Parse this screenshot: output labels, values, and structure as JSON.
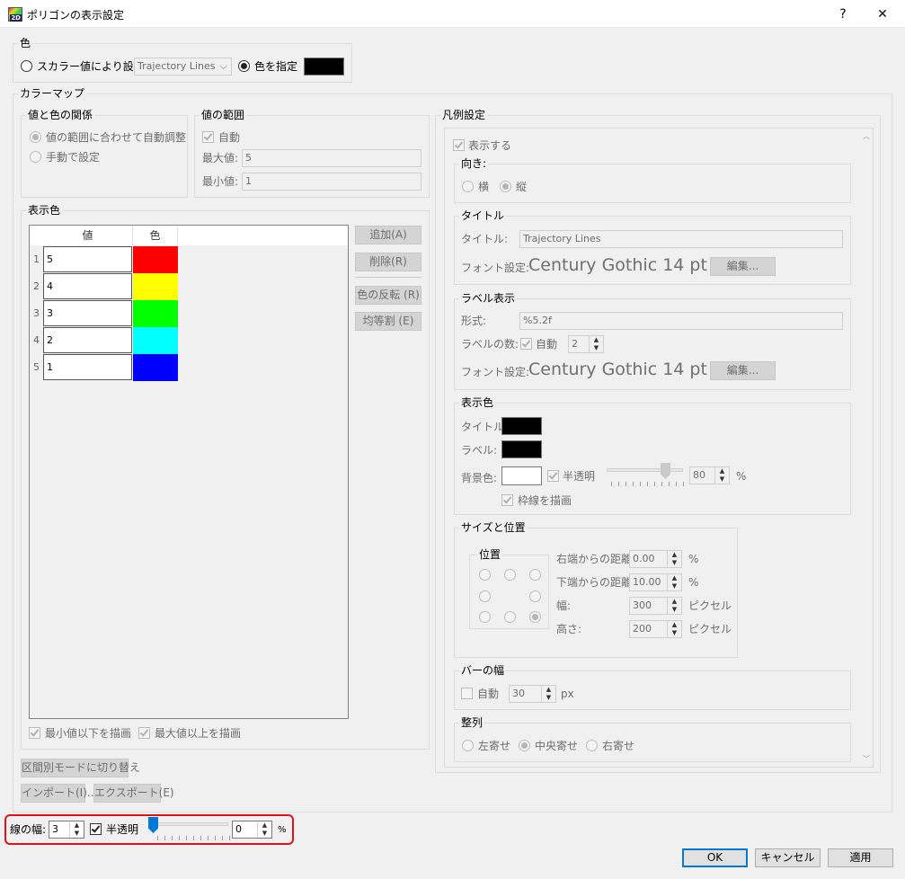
{
  "window": {
    "title": "ポリゴンの表示設定",
    "help_label": "?",
    "close_label": "✕"
  },
  "color_section": {
    "title": "色",
    "scalar_label": "スカラー値により設定",
    "scalar_select": "Trajectory Lines",
    "specify_label": "色を指定",
    "specify_color": "#000000"
  },
  "colormap": {
    "title": "カラーマップ",
    "relation": {
      "title": "値と色の関係",
      "auto_label": "値の範囲に合わせて自動調整",
      "manual_label": "手動で設定"
    },
    "range": {
      "title": "値の範囲",
      "auto_label": "自動",
      "max_label": "最大値:",
      "max_value": "5",
      "min_label": "最小値:",
      "min_value": "1"
    },
    "display_colors": {
      "title": "表示色",
      "col_value": "値",
      "col_color": "色",
      "rows": [
        {
          "index": "1",
          "value": "5",
          "color": "#ff0000"
        },
        {
          "index": "2",
          "value": "4",
          "color": "#ffff00"
        },
        {
          "index": "3",
          "value": "3",
          "color": "#00ff00"
        },
        {
          "index": "4",
          "value": "2",
          "color": "#00ffff"
        },
        {
          "index": "5",
          "value": "1",
          "color": "#0000ff"
        }
      ],
      "add_button": "追加(A)",
      "delete_button": "削除(R)",
      "invert_button": "色の反転 (R)",
      "equal_button": "均等割 (E)",
      "draw_below_min": "最小値以下を描画",
      "draw_above_max": "最大値以上を描画"
    },
    "switch_mode_button": "区間別モードに切り替え",
    "import_button": "インポート(I)...",
    "export_button": "エクスポート(E)"
  },
  "legend": {
    "title": "凡例設定",
    "show_label": "表示する",
    "orientation": {
      "title": "向き:",
      "horizontal": "横",
      "vertical": "縦"
    },
    "title_group": {
      "title": "タイトル",
      "title_label": "タイトル:",
      "title_value": "Trajectory Lines",
      "font_label": "フォント設定:",
      "font_preview": "Century Gothic 14 pt",
      "edit_button": "編集..."
    },
    "label_group": {
      "title": "ラベル表示",
      "format_label": "形式:",
      "format_value": "%5.2f",
      "count_label": "ラベルの数:",
      "auto_label": "自動",
      "count_value": "2",
      "font_label": "フォント設定:",
      "font_preview": "Century Gothic 14 pt",
      "edit_button": "編集..."
    },
    "color_group": {
      "title": "表示色",
      "title_label": "タイトル:",
      "title_color": "#000000",
      "label_label": "ラベル:",
      "label_color": "#000000",
      "bg_label": "背景色:",
      "bg_color": "#ffffff",
      "semi_label": "半透明",
      "semi_value": "80",
      "percent": "%",
      "border_label": "枠線を描画"
    },
    "size_group": {
      "title": "サイズと位置",
      "position_title": "位置",
      "right_label": "右端からの距離",
      "right_value": "0.00",
      "right_unit": "%",
      "bottom_label": "下端からの距離",
      "bottom_value": "10.00",
      "bottom_unit": "%",
      "width_label": "幅:",
      "width_value": "300",
      "width_unit": "ピクセル",
      "height_label": "高さ:",
      "height_value": "200",
      "height_unit": "ピクセル"
    },
    "bar_group": {
      "title": "バーの幅",
      "auto_label": "自動",
      "value": "30",
      "unit": "px"
    },
    "align_group": {
      "title": "整列",
      "left": "左寄せ",
      "center": "中央寄せ",
      "right": "右寄せ"
    }
  },
  "line": {
    "width_label": "線の幅:",
    "width_value": "3",
    "semi_label": "半透明",
    "opacity_value": "0",
    "percent": "%",
    "slider_value": 0
  },
  "footer": {
    "ok": "OK",
    "cancel": "キャンセル",
    "apply": "適用"
  }
}
